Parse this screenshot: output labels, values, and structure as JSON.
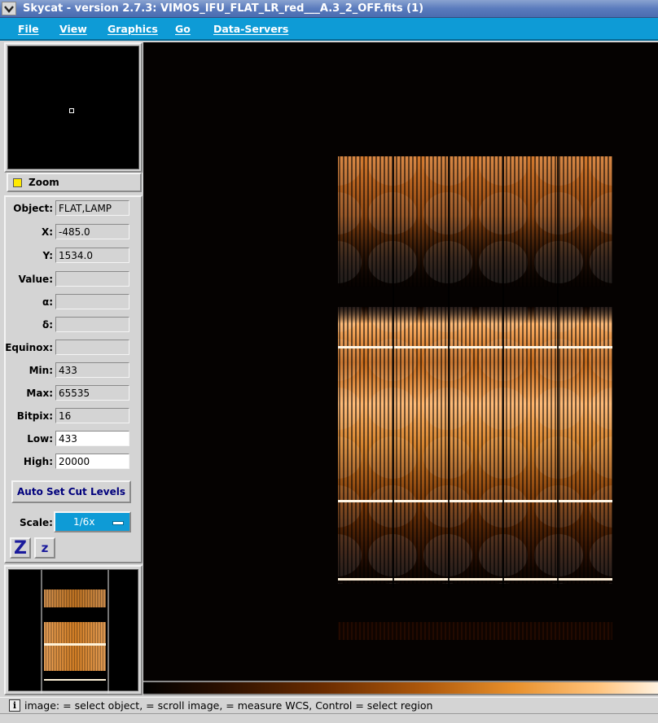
{
  "window": {
    "title": "Skycat - version 2.7.3: VIMOS_IFU_FLAT_LR_red___A.3_2_OFF.fits (1)"
  },
  "menu": {
    "items": [
      "File",
      "View",
      "Graphics",
      "Go",
      "Data-Servers"
    ]
  },
  "panner": {
    "zoom_label": "Zoom"
  },
  "info": {
    "object_label": "Object:",
    "object_value": "FLAT,LAMP",
    "x_label": "X:",
    "x_value": "-485.0",
    "y_label": "Y:",
    "y_value": "1534.0",
    "value_label": "Value:",
    "value_value": "",
    "alpha_label": "α:",
    "alpha_value": "",
    "delta_label": "δ:",
    "delta_value": "",
    "equinox_label": "Equinox:",
    "equinox_value": "",
    "min_label": "Min:",
    "min_value": "433",
    "max_label": "Max:",
    "max_value": "65535",
    "bitpix_label": "Bitpix:",
    "bitpix_value": "16",
    "low_label": "Low:",
    "low_value": "433",
    "high_label": "High:",
    "high_value": "20000"
  },
  "controls": {
    "auto_cut_label": "Auto Set Cut Levels",
    "scale_label": "Scale:",
    "scale_value": "1/6x",
    "zoom_in_glyph": "Z",
    "zoom_out_glyph": "z"
  },
  "status": {
    "icon_glyph": "i",
    "text": "image:  = select object,  = scroll image,  = measure WCS, Control  = select region"
  },
  "colors": {
    "menu_bar": "#0e9bd6",
    "title_bar": "#5a7bbd",
    "panel": "#d4d4d4",
    "spectrum_hot": "#ffa040"
  }
}
